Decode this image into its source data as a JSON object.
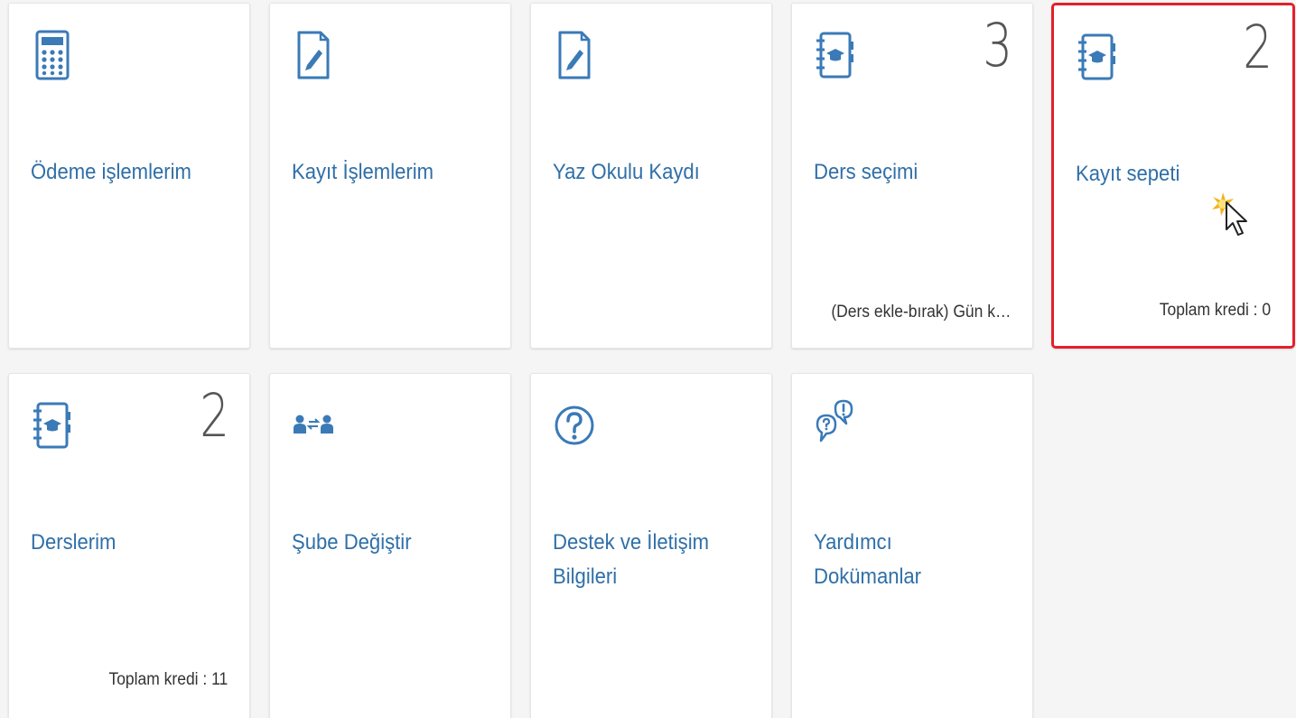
{
  "colors": {
    "icon": "#3a7ab7",
    "title": "#2f6fa8",
    "count": "#555555",
    "highlight": "#e3202a"
  },
  "tiles": [
    {
      "title": "Ödeme işlemlerim",
      "icon": "calculator-icon",
      "count": "",
      "footer": ""
    },
    {
      "title": "Kayıt İşlemlerim",
      "icon": "edit-document-icon",
      "count": "",
      "footer": ""
    },
    {
      "title": "Yaz Okulu Kaydı",
      "icon": "edit-document-icon",
      "count": "",
      "footer": ""
    },
    {
      "title": "Ders seçimi",
      "icon": "course-book-icon",
      "count": "3",
      "footer": "(Ders ekle-bırak) Gün k…"
    },
    {
      "title": "Kayıt sepeti",
      "icon": "course-book-icon",
      "count": "2",
      "footer": "Toplam kredi : 0"
    },
    {
      "title": "Derslerim",
      "icon": "course-book-icon",
      "count": "2",
      "footer": "Toplam kredi : 11"
    },
    {
      "title": "Şube Değiştir",
      "icon": "swap-users-icon",
      "count": "",
      "footer": ""
    },
    {
      "title": "Destek ve İletişim Bilgileri",
      "icon": "question-circle-icon",
      "count": "",
      "footer": ""
    },
    {
      "title": "Yardımcı Dokümanlar",
      "icon": "help-bubbles-icon",
      "count": "",
      "footer": ""
    }
  ]
}
